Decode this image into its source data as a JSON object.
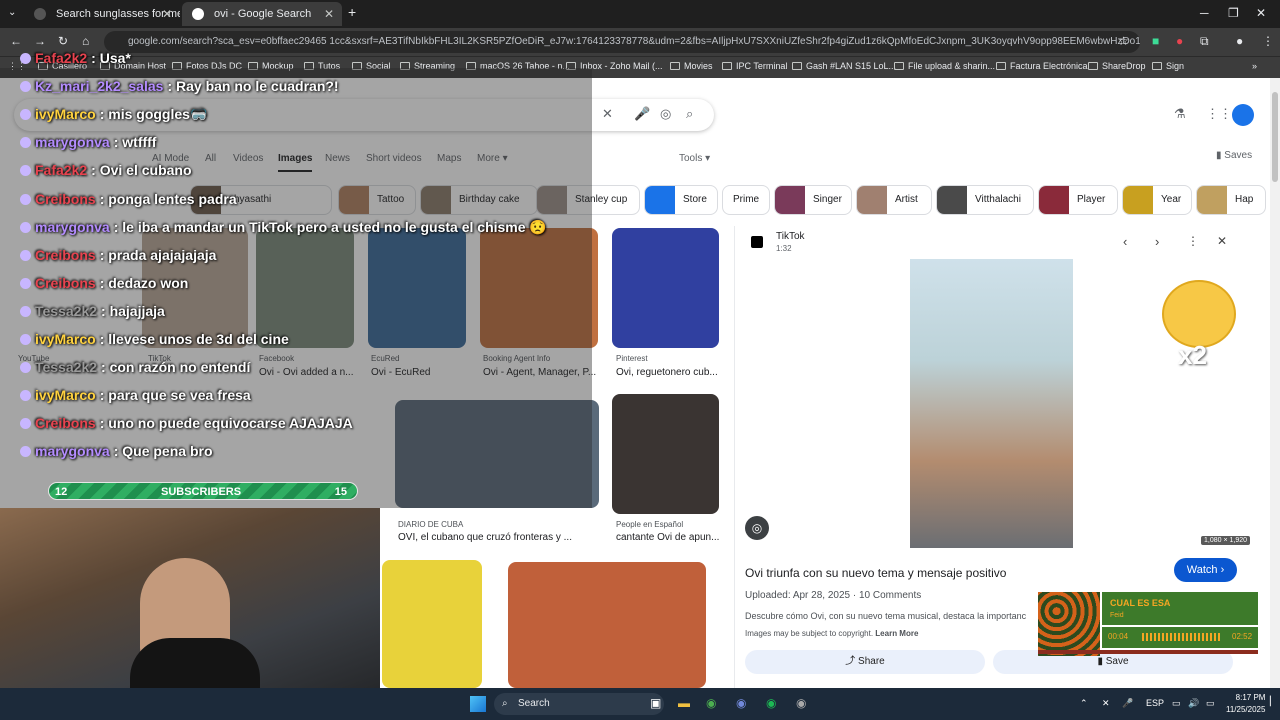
{
  "browser": {
    "tabs": [
      {
        "label": "Search sunglasses for men | SH"
      },
      {
        "label": "ovi - Google Search"
      }
    ],
    "new_tab": "+",
    "url": "google.com/search?sca_esv=e0bffaec29465 1cc&sxsrf=AE3TifNbIkbFHL3IL2KSR5PZfOeDiR_eJ7w:1764123378778&udm=2&fbs=AIljpHxU7SXXniUZfeShr2fp4giZud1z6kQpMfoEdCJxnpm_3UK3oyqvhV9opp98EEM6wbwHzDo1FKQA4Ghovh3..."
  },
  "bookmarks": [
    {
      "label": "Casillero"
    },
    {
      "label": "Domain Host"
    },
    {
      "label": "Fotos DJs DC"
    },
    {
      "label": "Mockup"
    },
    {
      "label": "Tutos"
    },
    {
      "label": "Social"
    },
    {
      "label": "Streaming"
    },
    {
      "label": "macOS 26 Tahoe - n..."
    },
    {
      "label": "Inbox - Zoho Mail (..."
    },
    {
      "label": "Movies"
    },
    {
      "label": "IPC Terminal"
    },
    {
      "label": "Gash #LAN S15 LoL..."
    },
    {
      "label": "File upload & sharin..."
    },
    {
      "label": "Factura Electrónica"
    },
    {
      "label": "ShareDrop"
    },
    {
      "label": "Sign"
    }
  ],
  "google": {
    "nav_tabs": [
      "AI Mode",
      "All",
      "Videos",
      "Images",
      "News",
      "Short videos",
      "Maps",
      "More"
    ],
    "active_tab": "Images",
    "tools": "Tools",
    "saves": "Saves",
    "chips": [
      "chyasathi",
      "Tattoo",
      "Birthday cake",
      "Stanley cup",
      "Store",
      "Prime",
      "Singer",
      "Artist",
      "Vitthalachi",
      "Player",
      "Year",
      "Hap"
    ],
    "results": [
      {
        "source": "YouTube",
        "caption": ""
      },
      {
        "source": "TikTok",
        "caption": ""
      },
      {
        "source": "Facebook",
        "caption": "Ovi - Ovi added a n..."
      },
      {
        "source": "EcuRed",
        "caption": "Ovi - EcuRed"
      },
      {
        "source": "Booking Agent Info",
        "caption": "Ovi - Agent, Manager, P..."
      },
      {
        "source": "Pinterest",
        "caption": "Ovi, reguetonero cub..."
      },
      {
        "source": "DIARIO DE CUBA",
        "caption": "OVI, el cubano que cruzó fronteras y ..."
      },
      {
        "source": "People en Español",
        "caption": "cantante Ovi de apun..."
      }
    ],
    "panel": {
      "source": "TikTok",
      "duration": "1:32",
      "dims": "1,080 × 1,920",
      "title": "Ovi triunfa con su nuevo tema y mensaje positivo",
      "watch": "Watch",
      "uploaded": "Uploaded: Apr 28, 2025",
      "comments": "10 Comments",
      "description": "Descubre cómo Ovi, con su nuevo tema musical, destaca la importanc",
      "copyright": "Images may be subject to copyright.",
      "learn_more": "Learn More",
      "share": "Share",
      "save": "Save"
    }
  },
  "stream": {
    "chat": [
      {
        "user": "Fafa2k2",
        "message": "Usa*",
        "color": "#e8434f"
      },
      {
        "user": "Kz_mari_2k2_salas",
        "message": "Ray ban no le cuadran?!",
        "color": "#b48cff"
      },
      {
        "user": "ivyMarco",
        "message": "mis goggles🥽",
        "color": "#ffd23f"
      },
      {
        "user": "marygonva",
        "message": "wtffff",
        "color": "#b48cff"
      },
      {
        "user": "Fafa2k2",
        "message": "Ovi el cubano",
        "color": "#e8434f"
      },
      {
        "user": "Creibons",
        "message": "ponga lentes padra",
        "color": "#e8434f"
      },
      {
        "user": "marygonva",
        "message": "le iba a mandar un TikTok pero a usted no le gusta el chisme 😟",
        "color": "#b48cff"
      },
      {
        "user": "Creibons",
        "message": "prada ajajajajaja",
        "color": "#e8434f"
      },
      {
        "user": "Creibons",
        "message": "dedazo won",
        "color": "#e8434f"
      },
      {
        "user": "Tessa2k2",
        "message": "hajajjaja",
        "color": "#9b9b9b"
      },
      {
        "user": "ivyMarco",
        "message": "llevese unos de 3d del cine",
        "color": "#ffd23f"
      },
      {
        "user": "Tessa2k2",
        "message": "con razón no entendí",
        "color": "#9b9b9b"
      },
      {
        "user": "ivyMarco",
        "message": "para que se vea fresa",
        "color": "#ffd23f"
      },
      {
        "user": "Creibons",
        "message": "uno no puede equivocarse AJAJAJA",
        "color": "#e8434f"
      },
      {
        "user": "marygonva",
        "message": "Que pena bro",
        "color": "#b48cff"
      }
    ],
    "subscribers": {
      "current": "12",
      "label": "SUBSCRIBERS",
      "goal": "15"
    },
    "emote_label": "x2",
    "music": {
      "track": "CUAL ES ESA",
      "artist": "Feid",
      "elapsed": "00:04",
      "total": "02:52"
    }
  },
  "taskbar": {
    "search": "Search",
    "lang": "ESP",
    "time": "8:17 PM",
    "date": "11/25/2025"
  }
}
